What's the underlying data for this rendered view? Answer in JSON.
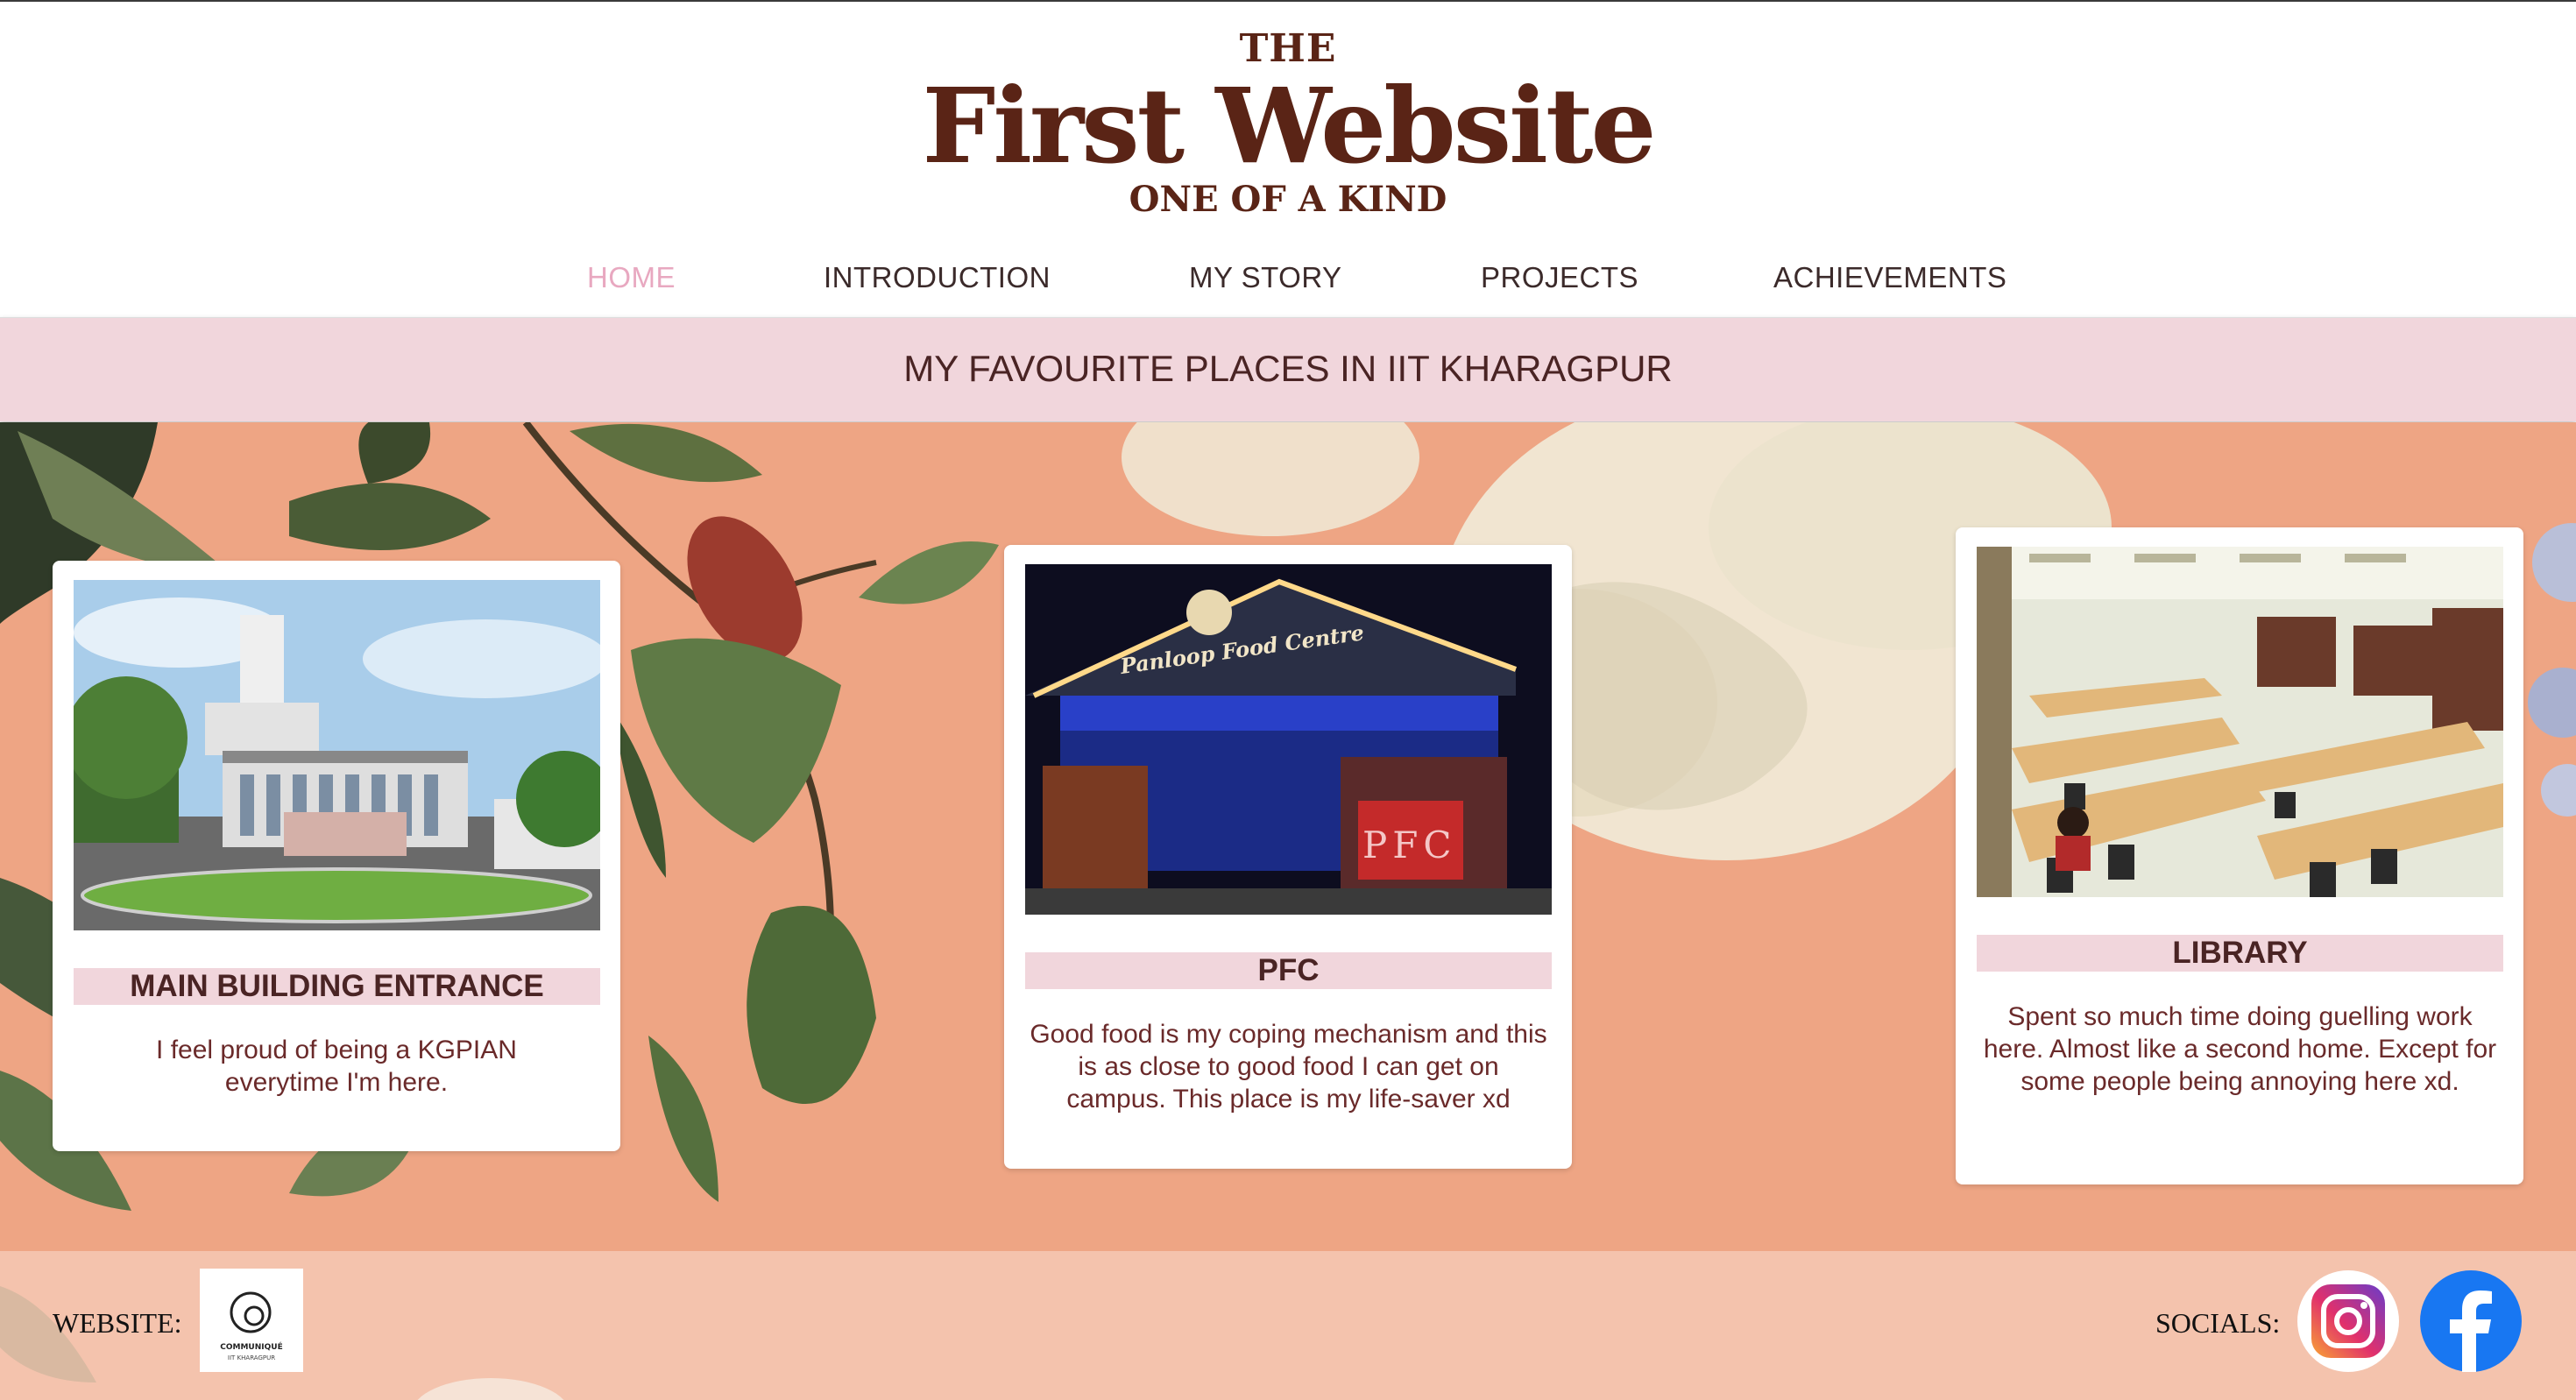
{
  "header": {
    "brand_the": "THE",
    "brand_title": "First Website",
    "brand_sub": "ONE OF A KIND"
  },
  "nav": {
    "items": [
      {
        "label": "HOME",
        "active": true
      },
      {
        "label": "INTRODUCTION",
        "active": false
      },
      {
        "label": "MY STORY",
        "active": false
      },
      {
        "label": "PROJECTS",
        "active": false
      },
      {
        "label": "ACHIEVEMENTS",
        "active": false
      }
    ]
  },
  "banner": {
    "text": "MY FAVOURITE PLACES IN IIT KHARAGPUR"
  },
  "cards": [
    {
      "title": "MAIN BUILDING ENTRANCE",
      "text": "I feel proud of being a KGPIAN everytime I'm here.",
      "photo_icon": "main-building-photo"
    },
    {
      "title": "PFC",
      "text": "Good food is my coping mechanism and this is as close to good food I can get on campus. This place is my life-saver xd",
      "photo_sign": "Panloop Food Centre",
      "photo_letters": "PFC",
      "photo_icon": "food-centre-photo"
    },
    {
      "title": "LIBRARY",
      "text": "Spent so much time doing guelling work here. Almost like a second home. Except for some people being annoying here xd.",
      "photo_icon": "library-photo"
    }
  ],
  "footer": {
    "website_label": "WEBSITE:",
    "socials_label": "SOCIALS:",
    "logo_text_1": "COMMUNIQUÉ",
    "logo_text_2": "IIT KHARAGPUR",
    "socials": [
      "instagram-icon",
      "facebook-icon"
    ]
  },
  "colors": {
    "brand": "#5a2416",
    "nav_active": "#e8a8c0",
    "banner_bg": "#f1d6dc",
    "main_bg": "#eea584",
    "footer_bg": "#f4c3ad",
    "facebook": "#1877f2"
  }
}
